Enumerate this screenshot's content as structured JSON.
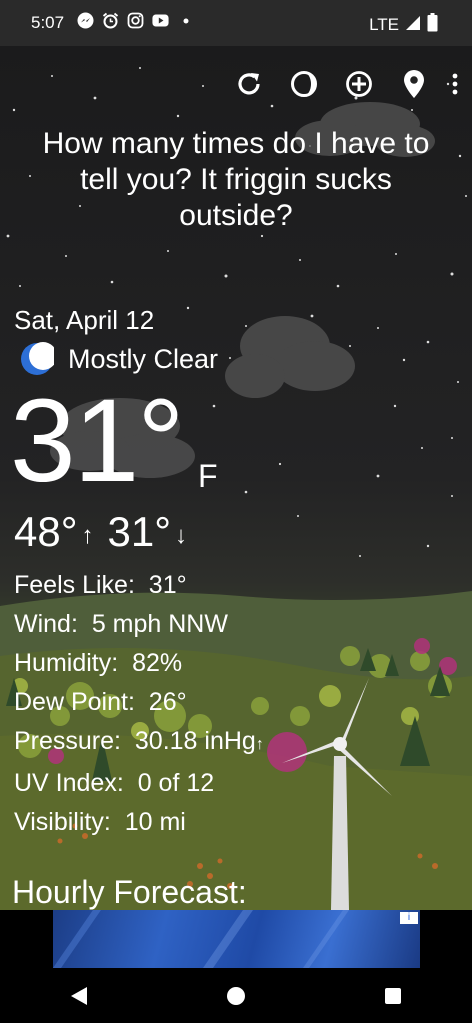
{
  "status_bar": {
    "time": "5:07",
    "notification_icons": [
      "messenger-icon",
      "alarm-icon",
      "instagram-icon",
      "youtube-icon",
      "dot-icon"
    ],
    "network": "LTE"
  },
  "toolbar": {
    "buttons": [
      "refresh-icon",
      "theme-icon",
      "add-location-icon",
      "location-pin-icon",
      "overflow-menu-icon"
    ]
  },
  "message": "How many times do I have to tell you? It friggin sucks outside?",
  "weather": {
    "date": "Sat, April 12",
    "condition": "Mostly Clear",
    "temperature": "31°",
    "unit": "F",
    "high": "48°",
    "low": "31°",
    "high_arrow": "↑",
    "low_arrow": "↓"
  },
  "details": {
    "feels_like_label": "Feels Like:",
    "feels_like_value": "31°",
    "wind_label": "Wind:",
    "wind_value": "5 mph NNW",
    "humidity_label": "Humidity:",
    "humidity_value": "82%",
    "dew_point_label": "Dew Point:",
    "dew_point_value": "26°",
    "pressure_label": "Pressure:",
    "pressure_value": "30.18 inHg",
    "pressure_trend": "↑",
    "uv_label": "UV Index:",
    "uv_value": "0 of 12",
    "visibility_label": "Visibility:",
    "visibility_value": "10 mi"
  },
  "hourly_title": "Hourly Forecast:",
  "ad": {
    "info_icon": "ad-info-icon"
  },
  "nav": {
    "buttons": [
      "back-icon",
      "home-icon",
      "recents-icon"
    ]
  },
  "colors": {
    "sky": "#1b1b1c",
    "hill": "#4b5b2f",
    "accent_moon": "#2d6fd6"
  }
}
